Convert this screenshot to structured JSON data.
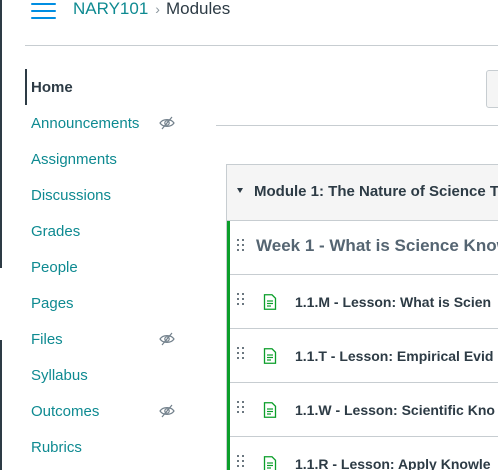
{
  "header": {
    "menu_icon": "hamburger-icon",
    "course_code": "NARY101",
    "separator": "›",
    "current_page": "Modules"
  },
  "course_nav": {
    "items": [
      {
        "label": "Home",
        "active": true,
        "hidden": false
      },
      {
        "label": "Announcements",
        "active": false,
        "hidden": true
      },
      {
        "label": "Assignments",
        "active": false,
        "hidden": false
      },
      {
        "label": "Discussions",
        "active": false,
        "hidden": false
      },
      {
        "label": "Grades",
        "active": false,
        "hidden": false
      },
      {
        "label": "People",
        "active": false,
        "hidden": false
      },
      {
        "label": "Pages",
        "active": false,
        "hidden": false
      },
      {
        "label": "Files",
        "active": false,
        "hidden": true
      },
      {
        "label": "Syllabus",
        "active": false,
        "hidden": false
      },
      {
        "label": "Outcomes",
        "active": false,
        "hidden": true
      },
      {
        "label": "Rubrics",
        "active": false,
        "hidden": false
      }
    ],
    "hidden_icon": "eye-slash-icon"
  },
  "module": {
    "title": "Module 1: The Nature of Science T",
    "toggle_icon": "caret-down-icon",
    "subheader": "Week 1 - What is Science Know",
    "items": [
      {
        "title": "1.1.M - Lesson: What is Scien",
        "icon": "page-icon"
      },
      {
        "title": "1.1.T - Lesson: Empirical Evid",
        "icon": "page-icon"
      },
      {
        "title": "1.1.W - Lesson: Scientific Kno",
        "icon": "page-icon"
      },
      {
        "title": "1.1.R - Lesson: Apply Knowle",
        "icon": "page-icon"
      }
    ]
  },
  "colors": {
    "link": "#0e8a91",
    "text": "#2d3b45",
    "published": "#0b9e2a",
    "border": "#c7cdd1",
    "menu": "#008ee2"
  }
}
